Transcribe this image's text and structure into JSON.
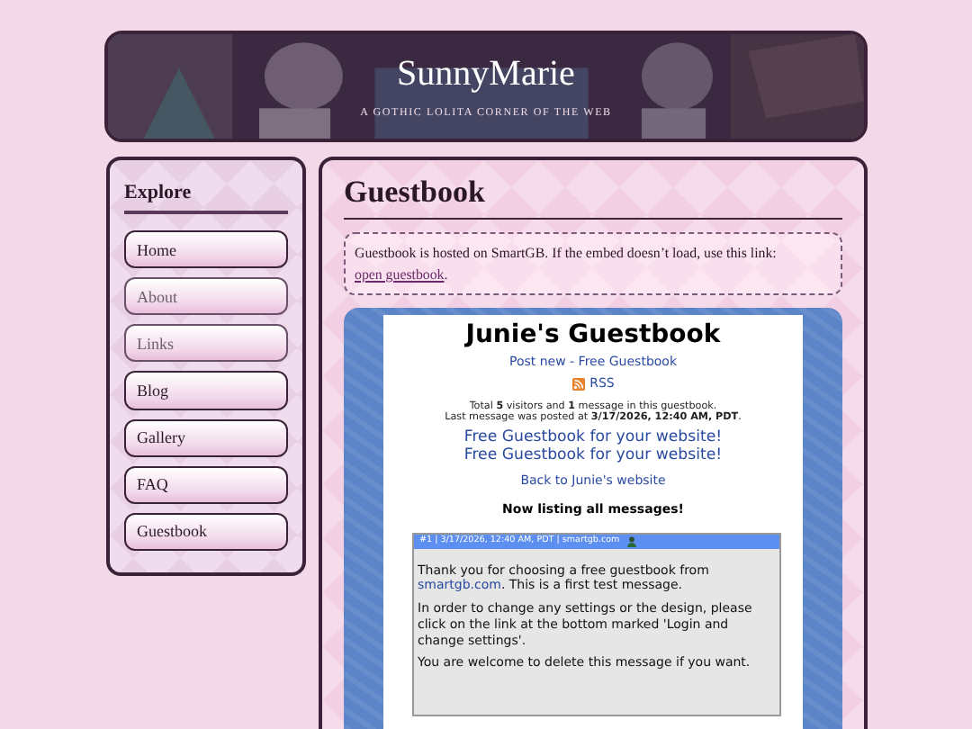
{
  "header": {
    "title": "SunnyMarie",
    "tagline": "A GOTHIC LOLITA CORNER OF THE WEB"
  },
  "sidebar": {
    "heading": "Explore",
    "items": [
      {
        "label": "Home",
        "visited": false
      },
      {
        "label": "About",
        "visited": true
      },
      {
        "label": "Links",
        "visited": true
      },
      {
        "label": "Blog",
        "visited": false
      },
      {
        "label": "Gallery",
        "visited": false
      },
      {
        "label": "FAQ",
        "visited": false
      },
      {
        "label": "Guestbook",
        "visited": false
      }
    ]
  },
  "main": {
    "title": "Guestbook",
    "notice": {
      "text": "Guestbook is hosted on SmartGB. If the embed doesn’t load, use this link: ",
      "link": "open guestbook",
      "after": "."
    }
  },
  "embed": {
    "title": "Junie's Guestbook",
    "post_link": "Post new - Free Guestbook",
    "rss": "RSS",
    "stats": [
      "Total **5** visitors and **1** message in this guestbook.",
      "Last message was posted at **3/17/2026, 12:40 AM, PDT**."
    ],
    "promo_links": [
      "Free Guestbook for your website!",
      "Free Guestbook for your website!"
    ],
    "back_link": "Back to Junie's website",
    "listing": "Now listing all messages!",
    "messages": [
      {
        "meta": "#1 | 3/17/2026, 12:40 AM, PDT | smartgb.com",
        "intro": {
          "before": "Thank you for choosing a free guestbook from ",
          "link": "smartgb.com",
          "after": ". This is a first test message."
        },
        "paragraphs": [
          "In order to change any settings or the design, please click on the link at the bottom marked 'Login and change settings'.",
          "You are welcome to delete this message if you want."
        ]
      }
    ]
  }
}
